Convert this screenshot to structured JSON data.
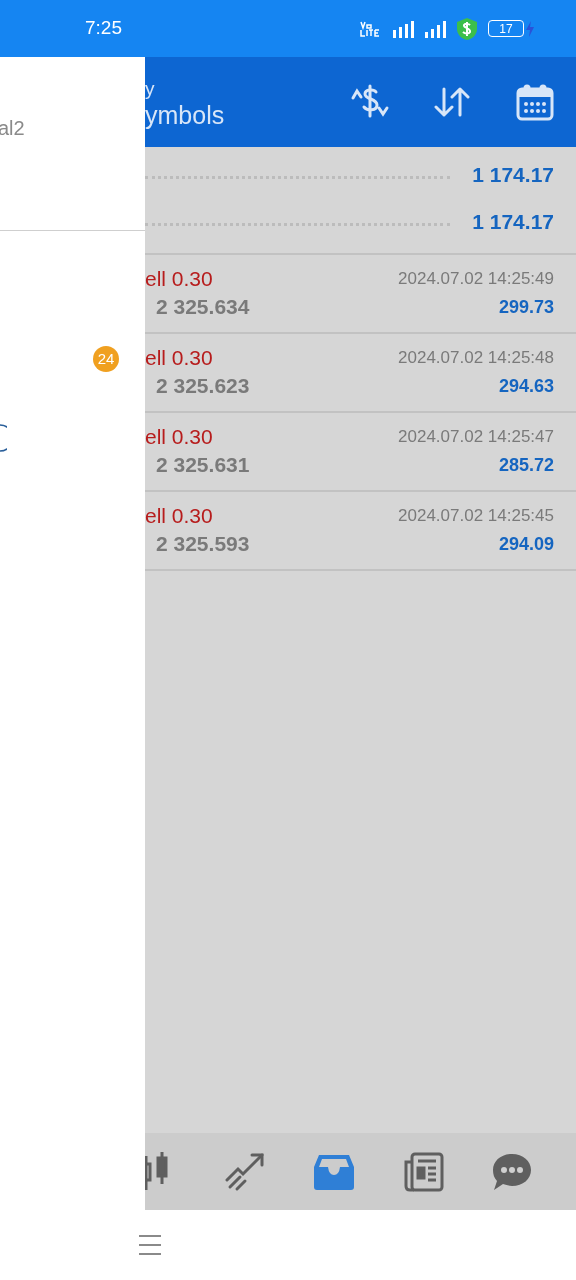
{
  "status_bar": {
    "time": "7:25",
    "battery": "17"
  },
  "drawer": {
    "account_text": "al2",
    "badge": "24"
  },
  "header": {
    "title_line_1": "y",
    "title_line_2": "ymbols"
  },
  "summary": [
    {
      "value": "1 174.17"
    },
    {
      "value": "1 174.17"
    }
  ],
  "positions": [
    {
      "type": "ell 0.30",
      "price": "2 325.634",
      "time": "2024.07.02 14:25:49",
      "profit": "299.73"
    },
    {
      "type": "ell 0.30",
      "price": "2 325.623",
      "time": "2024.07.02 14:25:48",
      "profit": "294.63"
    },
    {
      "type": "ell 0.30",
      "price": "2 325.631",
      "time": "2024.07.02 14:25:47",
      "profit": "285.72"
    },
    {
      "type": "ell 0.30",
      "price": "2 325.593",
      "time": "2024.07.02 14:25:45",
      "profit": "294.09"
    }
  ],
  "bottom_nav": [
    {
      "kind": "quotes",
      "selected": false
    },
    {
      "kind": "trade",
      "selected": false
    },
    {
      "kind": "history",
      "selected": true
    },
    {
      "kind": "news",
      "selected": false
    },
    {
      "kind": "chat",
      "selected": false
    }
  ]
}
